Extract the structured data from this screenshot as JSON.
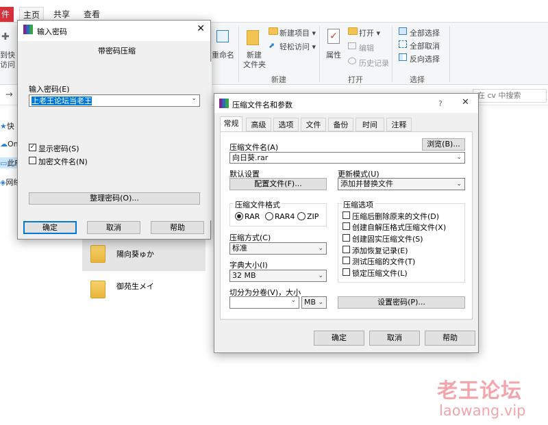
{
  "explorer": {
    "file_tab": "件",
    "tabs": [
      "主页",
      "共享",
      "查看"
    ],
    "pin_label_1": "到快",
    "pin_label_2": "访问",
    "rename": "重命名",
    "new_folder_1": "新建",
    "new_folder_2": "文件夹",
    "new_item": "新建项目",
    "easy_access": "轻松访问",
    "group_new": "新建",
    "properties": "属性",
    "open": "打开",
    "edit": "编辑",
    "history": "历史记录",
    "group_open": "打开",
    "select_all": "全部选择",
    "select_none": "全部取消",
    "invert_select": "反向选择",
    "group_select": "选择",
    "search_placeholder": "在 cv 中搜索",
    "nav": [
      "快",
      "On",
      "此F",
      "网络"
    ],
    "items": [
      "陽向葵ゅか",
      "御苑生メイ"
    ]
  },
  "pwd_dialog": {
    "title": "输入密码",
    "heading": "带密码压缩",
    "input_label": "输入密码(E)",
    "input_value": "上老王论坛当老王",
    "show_password": "显示密码(S)",
    "encrypt_names": "加密文件名(N)",
    "organize": "整理密码(O)...",
    "ok": "确定",
    "cancel": "取消",
    "help": "帮助"
  },
  "archive_dialog": {
    "title": "压缩文件名和参数",
    "help_mark": "?",
    "tabs": [
      "常规",
      "高级",
      "选项",
      "文件",
      "备份",
      "时间",
      "注释"
    ],
    "browse": "浏览(B)...",
    "archive_name_label": "压缩文件名(A)",
    "archive_name": "向日葵.rar",
    "default_settings": "默认设置",
    "profiles": "配置文件(F)...",
    "update_mode_label": "更新模式(U)",
    "update_mode": "添加并替换文件",
    "format_label": "压缩文件格式",
    "formats": [
      "RAR",
      "RAR4",
      "ZIP"
    ],
    "options_label": "压缩选项",
    "options": [
      "压缩后删除原来的文件(D)",
      "创建自解压格式压缩文件(X)",
      "创建固实压缩文件(S)",
      "添加恢复记录(E)",
      "测试压缩的文件(T)",
      "锁定压缩文件(L)"
    ],
    "method_label": "压缩方式(C)",
    "method": "标准",
    "dict_label": "字典大小(I)",
    "dict": "32 MB",
    "split_label": "切分为分卷(V)，大小",
    "split_unit": "MB",
    "set_password": "设置密码(P)...",
    "ok": "确定",
    "cancel": "取消",
    "help": "帮助"
  },
  "watermark": {
    "cn": "老王论坛",
    "url": "laowang.vip"
  }
}
